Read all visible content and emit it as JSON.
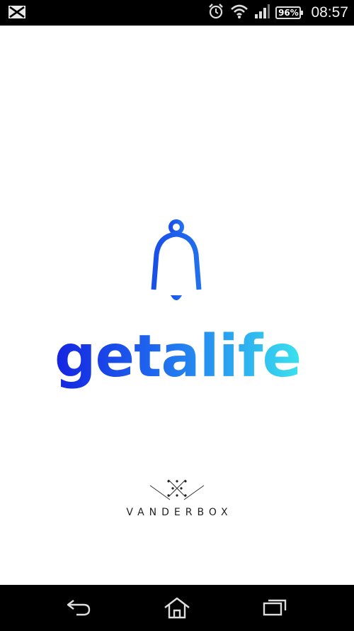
{
  "status_bar": {
    "notification_icon": "mail-icon",
    "alarm_icon": "alarm-clock-icon",
    "wifi_icon": "wifi-icon",
    "signal_icon": "signal-icon",
    "battery_level": "96%",
    "time": "08:57"
  },
  "splash": {
    "app_icon": "bell-icon",
    "app_name": "getalife",
    "gradient_colors": [
      "#1420e0",
      "#1e62ee",
      "#2aa4f0",
      "#3ce6ee"
    ],
    "publisher_logo": "vanderbox-logo",
    "publisher_name": "VANDERBOX"
  },
  "nav_bar": {
    "back_icon": "back-icon",
    "home_icon": "home-icon",
    "recents_icon": "recents-icon"
  }
}
